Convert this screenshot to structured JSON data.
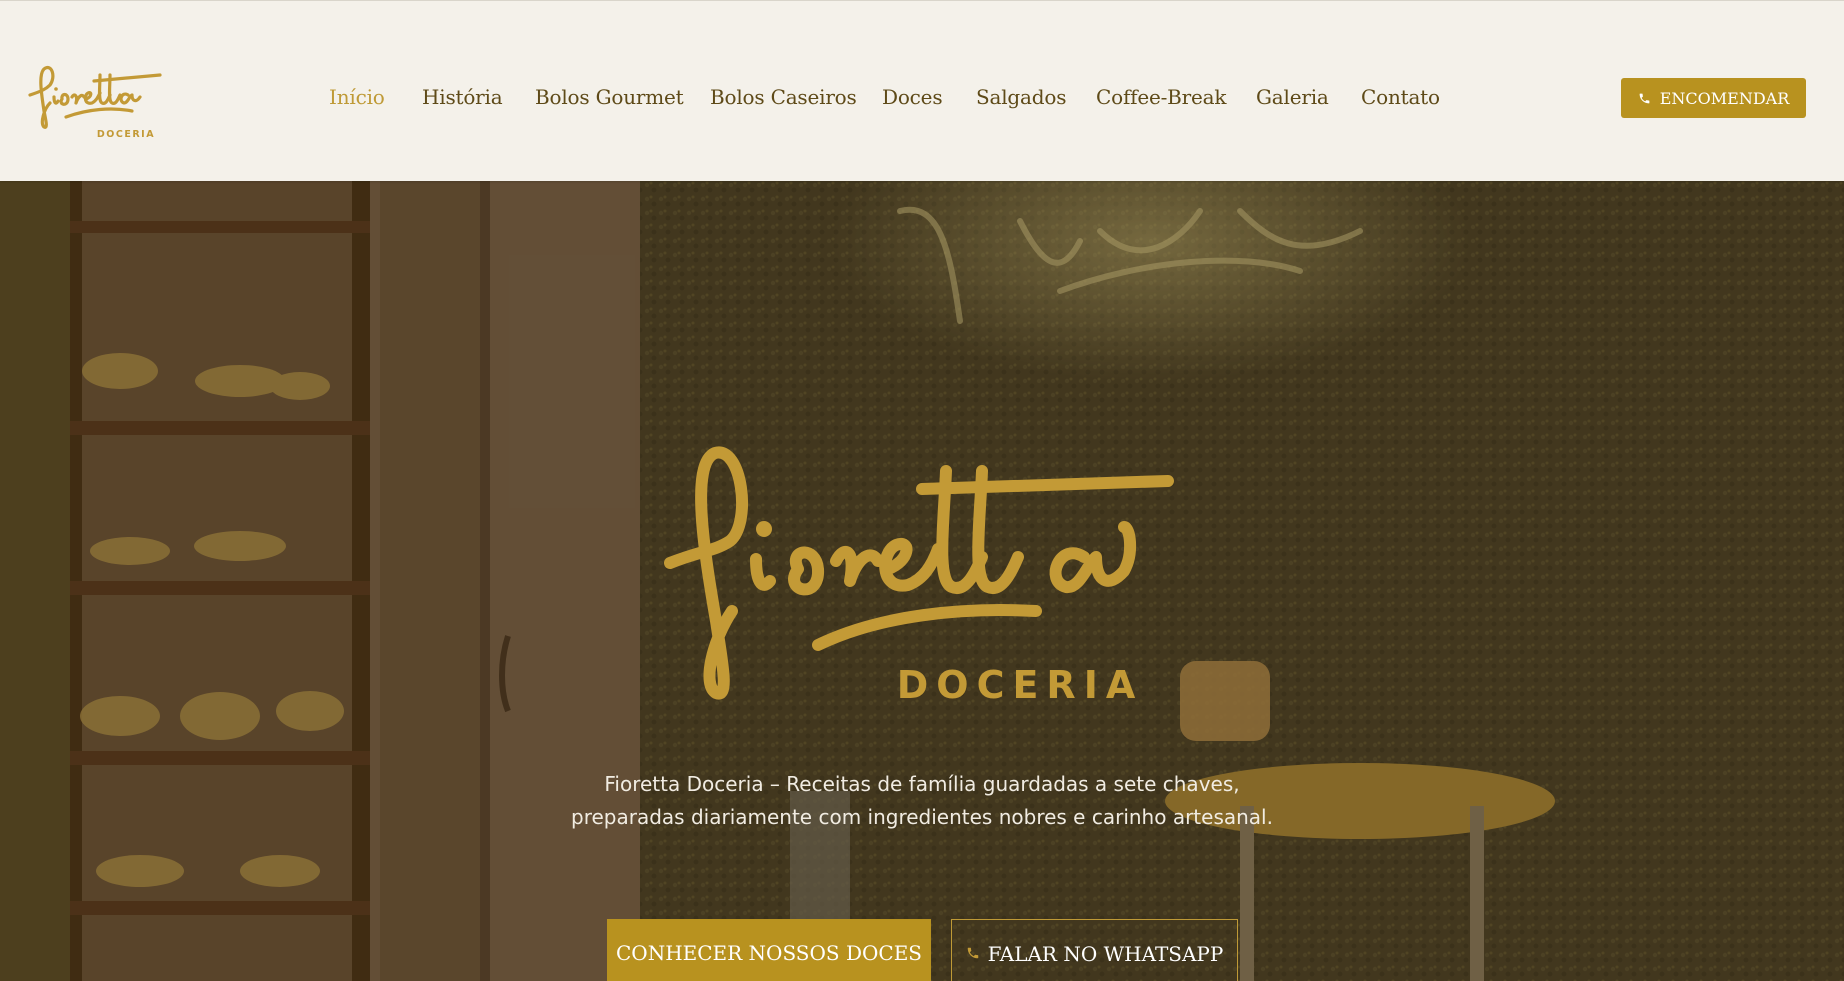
{
  "brand": {
    "logo_wordmark": "fioretta",
    "logo_subtitle": "DOCERIA",
    "accent": "#b8921f",
    "gold_logo": "#c39a36",
    "nav_text": "#5e4a18"
  },
  "nav": {
    "items": [
      {
        "label": "Início",
        "active": true
      },
      {
        "label": "História"
      },
      {
        "label": "Bolos Gourmet"
      },
      {
        "label": "Bolos Caseiros"
      },
      {
        "label": "Doces"
      },
      {
        "label": "Salgados"
      },
      {
        "label": "Coffee-Break"
      },
      {
        "label": "Galeria"
      },
      {
        "label": "Contato"
      }
    ],
    "order_button": {
      "label": "ENCOMENDAR",
      "icon": "phone-icon"
    }
  },
  "hero": {
    "logo_wordmark": "fioretta",
    "logo_subtitle": "DOCERIA",
    "description_line1": "Fioretta Doceria – Receitas de família guardadas a sete chaves,",
    "description_line2": "preparadas diariamente com ingredientes nobres e carinho artesanal.",
    "primary_button": "CONHECER NOSSOS DOCES",
    "secondary_button": {
      "label": "FALAR NO WHATSAPP",
      "icon": "phone-icon"
    }
  }
}
